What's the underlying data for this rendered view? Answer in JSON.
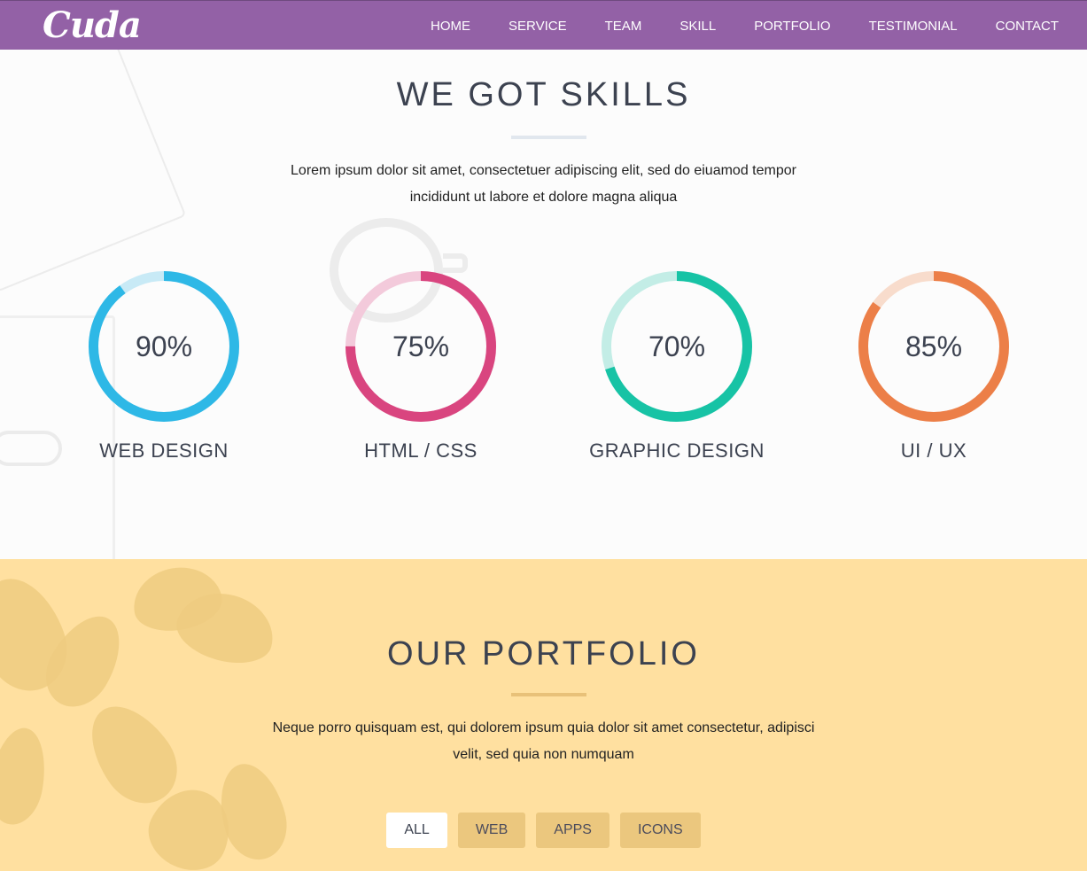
{
  "nav": {
    "logo": "Cuda",
    "items": [
      {
        "label": "HOME"
      },
      {
        "label": "SERVICE"
      },
      {
        "label": "TEAM"
      },
      {
        "label": "SKILL"
      },
      {
        "label": "PORTFOLIO"
      },
      {
        "label": "TESTIMONIAL"
      },
      {
        "label": "CONTACT"
      }
    ]
  },
  "skills": {
    "title": "WE GOT SKILLS",
    "text_line1": "Lorem ipsum dolor sit amet, consectetuer adipiscing elit, sed do eiuamod tempor",
    "text_line2": "incididunt ut labore et dolore magna aliqua",
    "items": [
      {
        "label": "WEB DESIGN",
        "percent_text": "90%",
        "value": 90,
        "color": "#2eb8e6",
        "track": "#c8eaf6"
      },
      {
        "label": "HTML / CSS",
        "percent_text": "75%",
        "value": 75,
        "color": "#d9457f",
        "track": "#f3cadb"
      },
      {
        "label": "GRAPHIC DESIGN",
        "percent_text": "70%",
        "value": 70,
        "color": "#17c3a5",
        "track": "#c3ede6"
      },
      {
        "label": "UI / UX",
        "percent_text": "85%",
        "value": 85,
        "color": "#ec7f48",
        "track": "#f8dccc"
      }
    ]
  },
  "portfolio": {
    "title": "OUR PORTFOLIO",
    "text_line1": "Neque porro quisquam est, qui dolorem ipsum quia dolor sit amet consectetur, adipisci",
    "text_line2": "velit, sed quia non numquam",
    "filters": [
      {
        "label": "ALL",
        "active": true
      },
      {
        "label": "WEB",
        "active": false
      },
      {
        "label": "APPS",
        "active": false
      },
      {
        "label": "ICONS",
        "active": false
      }
    ]
  },
  "colors": {
    "nav_bg": "#9361a6",
    "portfolio_bg": "#ffe0a0",
    "heading": "#3c4250"
  }
}
